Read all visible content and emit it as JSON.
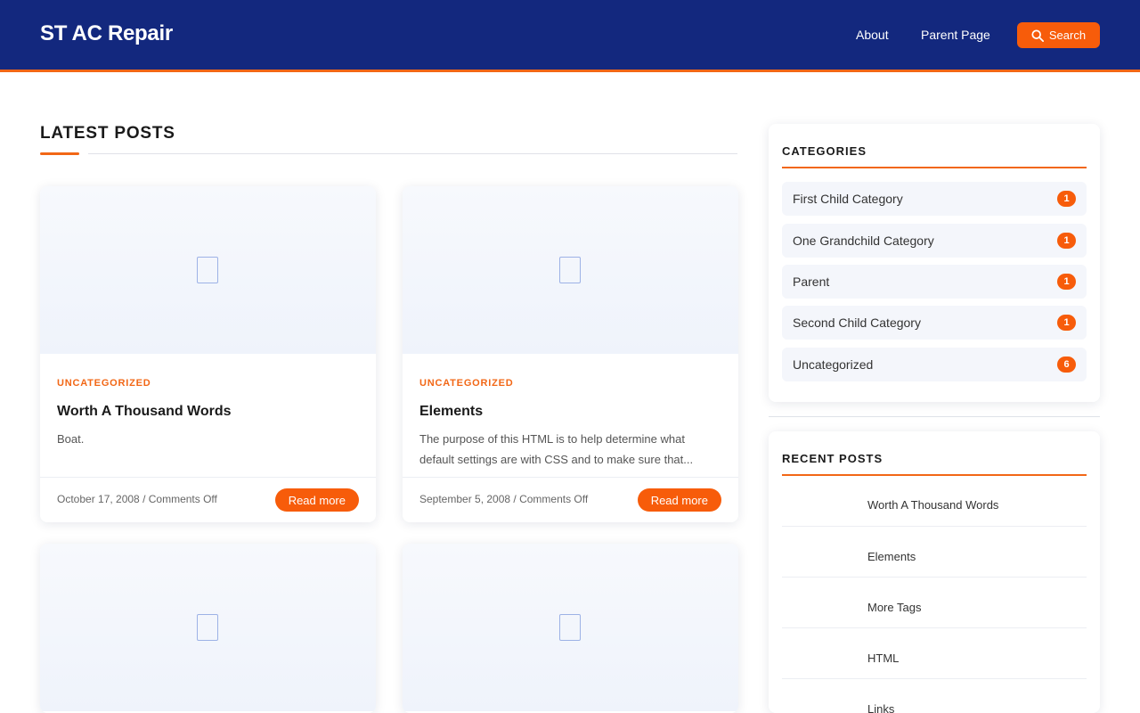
{
  "header": {
    "site_title": "ST AC Repair",
    "nav": [
      "About",
      "Parent Page"
    ],
    "search_label": "Search"
  },
  "main": {
    "section_title": "LATEST POSTS",
    "posts": [
      {
        "category": "UNCATEGORIZED",
        "title": "Worth A Thousand Words",
        "excerpt": "Boat.",
        "meta": "October 17, 2008 / Comments Off",
        "read_more": "Read more"
      },
      {
        "category": "UNCATEGORIZED",
        "title": "Elements",
        "excerpt": "The purpose of this HTML is to help determine what default settings are with CSS and to make sure that...",
        "meta": "September 5, 2008 / Comments Off",
        "read_more": "Read more"
      }
    ]
  },
  "sidebar": {
    "categories_title": "CATEGORIES",
    "categories": [
      {
        "label": "First Child Category",
        "count": "1"
      },
      {
        "label": "One Grandchild Category",
        "count": "1"
      },
      {
        "label": "Parent",
        "count": "1"
      },
      {
        "label": "Second Child Category",
        "count": "1"
      },
      {
        "label": "Uncategorized",
        "count": "6"
      }
    ],
    "recent_title": "RECENT POSTS",
    "recent": [
      "Worth A Thousand Words",
      "Elements",
      "More Tags",
      "HTML",
      "Links"
    ]
  },
  "colors": {
    "header_bg": "#13287e",
    "accent": "#f75c0a"
  },
  "icons": [
    "search-icon",
    "image-placeholder-icon"
  ]
}
